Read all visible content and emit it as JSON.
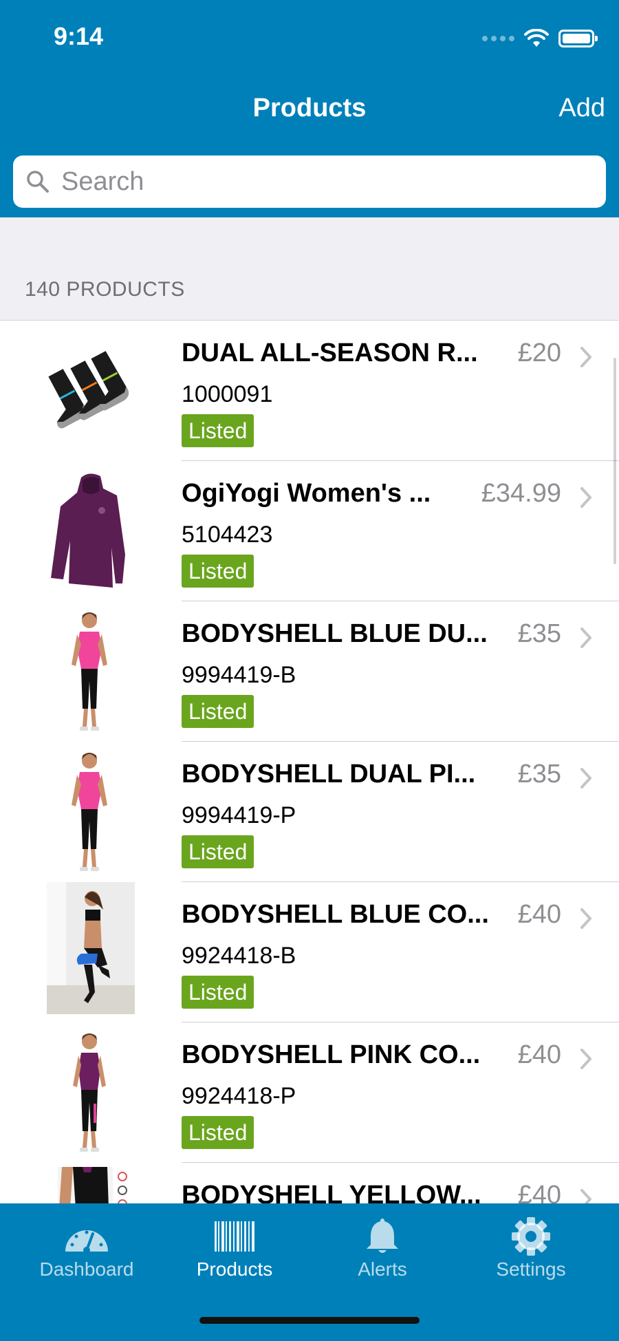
{
  "status_bar": {
    "time": "9:14"
  },
  "nav": {
    "title": "Products",
    "add_label": "Add"
  },
  "search": {
    "placeholder": "Search"
  },
  "section": {
    "title": "140 PRODUCTS"
  },
  "products": [
    {
      "name": "DUAL ALL-SEASON R...",
      "price": "£20",
      "sku": "1000091",
      "status": "Listed",
      "image": "socks"
    },
    {
      "name": "OgiYogi Women's ...",
      "price": "£34.99",
      "sku": "5104423",
      "status": "Listed",
      "image": "purple-hoodie"
    },
    {
      "name": "BODYSHELL BLUE DU...",
      "price": "£35",
      "sku": "9994419-B",
      "status": "Listed",
      "image": "woman-pink-top"
    },
    {
      "name": "BODYSHELL DUAL PI...",
      "price": "£35",
      "sku": "9994419-P",
      "status": "Listed",
      "image": "woman-pink-top"
    },
    {
      "name": "BODYSHELL BLUE CO...",
      "price": "£40",
      "sku": "9924418-B",
      "status": "Listed",
      "image": "woman-leggings-photo"
    },
    {
      "name": "BODYSHELL PINK CO...",
      "price": "£40",
      "sku": "9924418-P",
      "status": "Listed",
      "image": "woman-purple-top"
    },
    {
      "name": "BODYSHELL YELLOW...",
      "price": "£40",
      "sku": "",
      "status": "",
      "image": "leggings-closeup"
    }
  ],
  "tabs": [
    {
      "label": "Dashboard",
      "icon": "gauge-icon",
      "active": false
    },
    {
      "label": "Products",
      "icon": "barcode-icon",
      "active": true
    },
    {
      "label": "Alerts",
      "icon": "bell-icon",
      "active": false
    },
    {
      "label": "Settings",
      "icon": "gear-icon",
      "active": false
    }
  ],
  "colors": {
    "brand_blue": "#0080b8",
    "listed_green": "#6aa51e",
    "price_gray": "#8e8e93",
    "section_bg": "#efeff4"
  }
}
